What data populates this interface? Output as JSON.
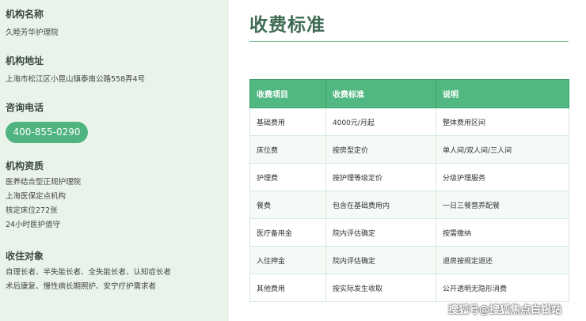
{
  "sidebar": {
    "name": {
      "title": "机构名称",
      "lines": [
        "久睦芳华护理院"
      ]
    },
    "address": {
      "title": "机构地址",
      "lines": [
        "上海市松江区小昆山镇泰南公路558弄4号"
      ]
    },
    "phone": {
      "title": "咨询电话",
      "number": "400-855-0290"
    },
    "qualification": {
      "title": "机构资质",
      "lines": [
        "医养结合型正规护理院",
        "上海医保定点机构",
        "核定床位272张",
        "24小时医护值守"
      ]
    },
    "audience": {
      "title": "收住对象",
      "lines": [
        "自理长者、半失能长者、全失能长者、认知症长者",
        "术后康复、慢性病长期照护、安宁疗护需求者"
      ]
    }
  },
  "main": {
    "title": "收费标准",
    "table": {
      "headers": [
        "收费项目",
        "收费标准",
        "说明"
      ],
      "rows": [
        [
          "基础费用",
          "4000元/月起",
          "整体费用区间"
        ],
        [
          "床位费",
          "按房型定价",
          "单人间/双人间/三人间"
        ],
        [
          "护理费",
          "按护理等级定价",
          "分级护理服务"
        ],
        [
          "餐费",
          "包含在基础费用内",
          "一日三餐营养配餐"
        ],
        [
          "医疗备用金",
          "院内评估确定",
          "按需缴纳"
        ],
        [
          "入住押金",
          "院内评估确定",
          "退房按规定退还"
        ],
        [
          "其他费用",
          "按实际发生收取",
          "公开透明无隐形消费"
        ]
      ]
    }
  },
  "watermark": "搜狐号@搜狐焦点白银站",
  "colors": {
    "accent": "#52b882",
    "sidebar_bg": "#e9f3ea",
    "title": "#3f6b53"
  }
}
